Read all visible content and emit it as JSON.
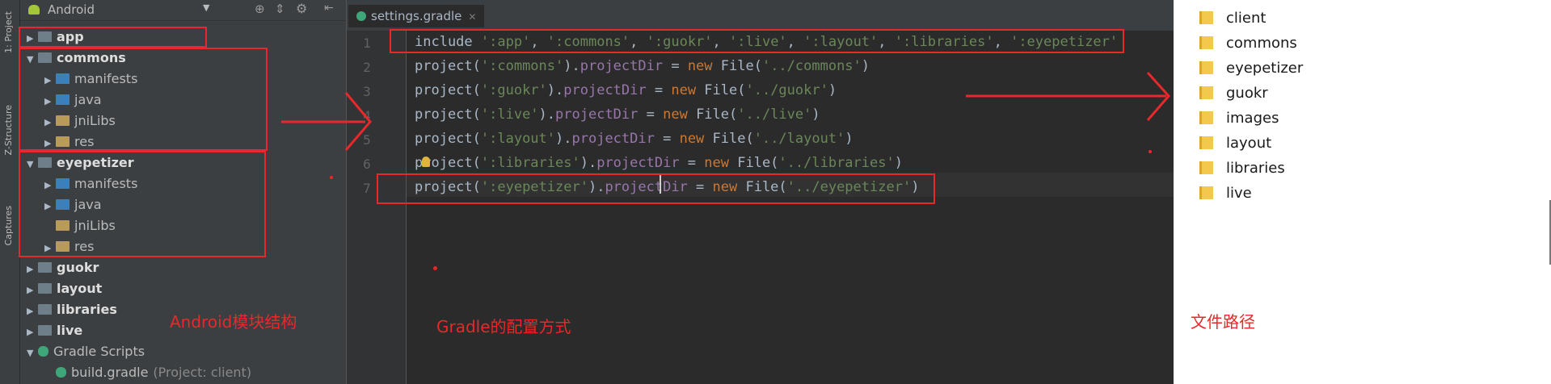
{
  "side_tabs": {
    "project": "1: Project",
    "structure": "Z-Structure",
    "captures": "Captures"
  },
  "project_panel": {
    "view_selector": "Android",
    "tree": [
      {
        "label": "app",
        "bold": true,
        "arrow": "▶",
        "icon": "module"
      },
      {
        "label": "commons",
        "bold": true,
        "arrow": "▼",
        "icon": "module"
      },
      {
        "label": "manifests",
        "arrow": "▶",
        "icon": "folder-blue"
      },
      {
        "label": "java",
        "arrow": "▶",
        "icon": "folder-blue"
      },
      {
        "label": "jniLibs",
        "arrow": "▶",
        "icon": "folder-lib"
      },
      {
        "label": "res",
        "arrow": "▶",
        "icon": "folder-lib"
      },
      {
        "label": "eyepetizer",
        "bold": true,
        "arrow": "▼",
        "icon": "module"
      },
      {
        "label": "manifests",
        "arrow": "▶",
        "icon": "folder-blue"
      },
      {
        "label": "java",
        "arrow": "▶",
        "icon": "folder-blue"
      },
      {
        "label": "jniLibs",
        "arrow": "",
        "icon": "folder-lib"
      },
      {
        "label": "res",
        "arrow": "▶",
        "icon": "folder-lib"
      },
      {
        "label": "guokr",
        "bold": true,
        "arrow": "▶",
        "icon": "module"
      },
      {
        "label": "layout",
        "bold": true,
        "arrow": "▶",
        "icon": "module"
      },
      {
        "label": "libraries",
        "bold": true,
        "arrow": "▶",
        "icon": "module"
      },
      {
        "label": "live",
        "bold": true,
        "arrow": "▶",
        "icon": "module"
      },
      {
        "label": "Gradle Scripts",
        "arrow": "▼",
        "icon": "gradle"
      },
      {
        "label": "build.gradle",
        "suffix": "(Project: client)",
        "arrow": "",
        "icon": "gradle"
      }
    ]
  },
  "editor": {
    "tab_label": "settings.gradle",
    "line_numbers": [
      "1",
      "2",
      "3",
      "4",
      "5",
      "6",
      "7"
    ],
    "lines": [
      [
        {
          "t": "include ",
          "c": "plain"
        },
        {
          "t": "':app'",
          "c": "str"
        },
        {
          "t": ", ",
          "c": "plain"
        },
        {
          "t": "':commons'",
          "c": "str"
        },
        {
          "t": ", ",
          "c": "plain"
        },
        {
          "t": "':guokr'",
          "c": "str"
        },
        {
          "t": ", ",
          "c": "plain"
        },
        {
          "t": "':live'",
          "c": "str"
        },
        {
          "t": ", ",
          "c": "plain"
        },
        {
          "t": "':layout'",
          "c": "str"
        },
        {
          "t": ", ",
          "c": "plain"
        },
        {
          "t": "':libraries'",
          "c": "str"
        },
        {
          "t": ", ",
          "c": "plain"
        },
        {
          "t": "':eyepetizer'",
          "c": "str"
        }
      ],
      [
        {
          "t": "project(",
          "c": "plain"
        },
        {
          "t": "':commons'",
          "c": "str"
        },
        {
          "t": ").",
          "c": "plain"
        },
        {
          "t": "projectDir",
          "c": "prop"
        },
        {
          "t": " = ",
          "c": "plain"
        },
        {
          "t": "new ",
          "c": "kw"
        },
        {
          "t": "File(",
          "c": "plain"
        },
        {
          "t": "'../commons'",
          "c": "str"
        },
        {
          "t": ")",
          "c": "plain"
        }
      ],
      [
        {
          "t": "project(",
          "c": "plain"
        },
        {
          "t": "':guokr'",
          "c": "str"
        },
        {
          "t": ").",
          "c": "plain"
        },
        {
          "t": "projectDir",
          "c": "prop"
        },
        {
          "t": " = ",
          "c": "plain"
        },
        {
          "t": "new ",
          "c": "kw"
        },
        {
          "t": "File(",
          "c": "plain"
        },
        {
          "t": "'../guokr'",
          "c": "str"
        },
        {
          "t": ")",
          "c": "plain"
        }
      ],
      [
        {
          "t": "project(",
          "c": "plain"
        },
        {
          "t": "':live'",
          "c": "str"
        },
        {
          "t": ").",
          "c": "plain"
        },
        {
          "t": "projectDir",
          "c": "prop"
        },
        {
          "t": " = ",
          "c": "plain"
        },
        {
          "t": "new ",
          "c": "kw"
        },
        {
          "t": "File(",
          "c": "plain"
        },
        {
          "t": "'../live'",
          "c": "str"
        },
        {
          "t": ")",
          "c": "plain"
        }
      ],
      [
        {
          "t": "project(",
          "c": "plain"
        },
        {
          "t": "':layout'",
          "c": "str"
        },
        {
          "t": ").",
          "c": "plain"
        },
        {
          "t": "projectDir",
          "c": "prop"
        },
        {
          "t": " = ",
          "c": "plain"
        },
        {
          "t": "new ",
          "c": "kw"
        },
        {
          "t": "File(",
          "c": "plain"
        },
        {
          "t": "'../layout'",
          "c": "str"
        },
        {
          "t": ")",
          "c": "plain"
        }
      ],
      [
        {
          "t": "project(",
          "c": "plain"
        },
        {
          "t": "':libraries'",
          "c": "str"
        },
        {
          "t": ").",
          "c": "plain"
        },
        {
          "t": "projectDir",
          "c": "prop"
        },
        {
          "t": " = ",
          "c": "plain"
        },
        {
          "t": "new ",
          "c": "kw"
        },
        {
          "t": "File(",
          "c": "plain"
        },
        {
          "t": "'../libraries'",
          "c": "str"
        },
        {
          "t": ")",
          "c": "plain"
        }
      ],
      [
        {
          "t": "project(",
          "c": "plain"
        },
        {
          "t": "':eyepetizer'",
          "c": "str"
        },
        {
          "t": ").",
          "c": "plain"
        },
        {
          "t": "projectDir",
          "c": "prop"
        },
        {
          "t": " = ",
          "c": "plain"
        },
        {
          "t": "new ",
          "c": "kw"
        },
        {
          "t": "File(",
          "c": "plain"
        },
        {
          "t": "'../eyepetizer'",
          "c": "str"
        },
        {
          "t": ")",
          "c": "plain"
        }
      ]
    ]
  },
  "explorer": {
    "folders": [
      "client",
      "commons",
      "eyepetizer",
      "guokr",
      "images",
      "layout",
      "libraries",
      "live"
    ]
  },
  "annotations": {
    "android_structure": "Android模块结构",
    "gradle_config": "Gradle的配置方式",
    "file_path": "文件路径"
  },
  "colors": {
    "annotation_red": "#e8282a",
    "string_green": "#6a8759",
    "keyword_orange": "#cc7832",
    "property_purple": "#9876aa"
  }
}
